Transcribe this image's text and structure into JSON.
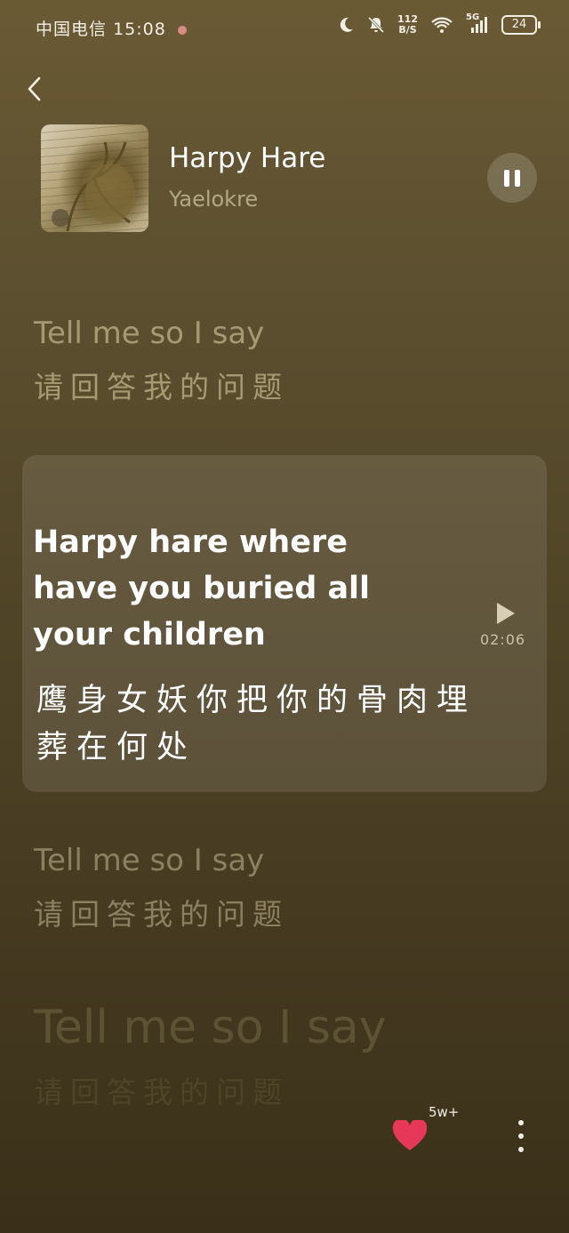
{
  "status_bar": {
    "carrier": "中国电信",
    "time": "15:08",
    "net_speed_value": "112",
    "net_speed_unit": "B/S",
    "network": "5G",
    "battery": "24"
  },
  "player": {
    "title": "Harpy Hare",
    "artist": "Yaelokre",
    "state": "playing"
  },
  "lyrics": [
    {
      "en": "Tell me so I say",
      "zh": "请回答我的问题"
    },
    {
      "en": "Harpy hare where have you buried all your children",
      "zh": "鹰身女妖你把你的骨肉埋葬在何处"
    },
    {
      "en": "Tell me so I say",
      "zh": "请回答我的问题"
    },
    {
      "en": "Tell me so I say",
      "zh": "请回答我的问题"
    }
  ],
  "current_line": {
    "timestamp": "02:06"
  },
  "actions": {
    "like_count": "5w+"
  },
  "colors": {
    "heart": "#e8385a",
    "background_top": "#6a5a34",
    "background_bottom": "#3a3019"
  }
}
